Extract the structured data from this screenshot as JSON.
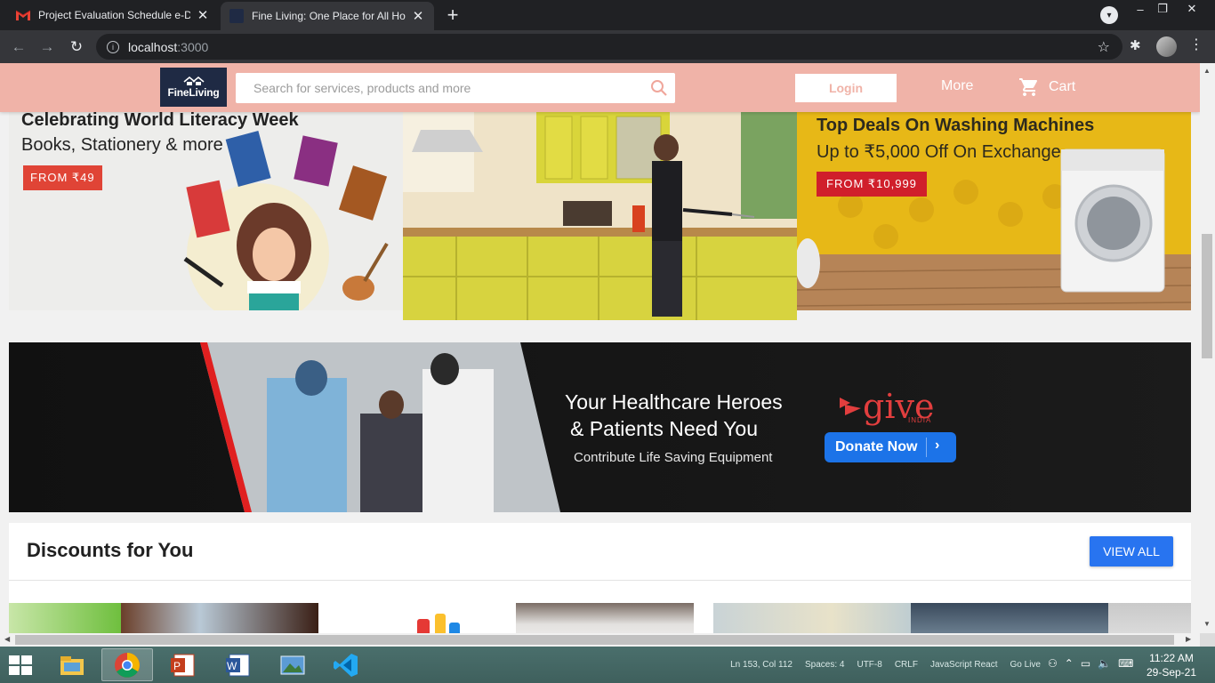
{
  "browser": {
    "tabs": [
      {
        "title": "Project Evaluation Schedule e-DA",
        "active": false
      },
      {
        "title": "Fine Living: One Place for All Hou",
        "active": true
      }
    ],
    "url_host": "localhost",
    "url_port": ":3000"
  },
  "header": {
    "logo_text": "FineLiving",
    "search_placeholder": "Search for services, products and more",
    "login_label": "Login",
    "more_label": "More",
    "cart_label": "Cart"
  },
  "banners": {
    "literacy": {
      "title": "Celebrating World Literacy Week",
      "subtitle": "Books, Stationery & more",
      "tag": "FROM ₹49"
    },
    "washing": {
      "title": "Top Deals On Washing Machines",
      "subtitle": "Up to ₹5,000 Off On Exchange",
      "tag": "FROM ₹10,999"
    },
    "healthcare": {
      "line1": "Your Healthcare Heroes",
      "line2": "& Patients Need You",
      "line3": "Contribute Life Saving Equipment",
      "brand": "give",
      "brand_sub": "INDIA",
      "button": "Donate Now"
    }
  },
  "discounts": {
    "title": "Discounts for You",
    "view_all": "VIEW ALL"
  },
  "taskbar": {
    "status_items": [
      "Ln 153, Col 112",
      "Spaces: 4",
      "UTF-8",
      "CRLF",
      "JavaScript React",
      "Go Live"
    ],
    "time": "11:22 AM",
    "date": "29-Sep-21"
  },
  "colors": {
    "header_bg": "#f0b3a8",
    "view_all_bg": "#2874f0",
    "donate_bg": "#1c73e8",
    "tag_red": "#e04436"
  }
}
